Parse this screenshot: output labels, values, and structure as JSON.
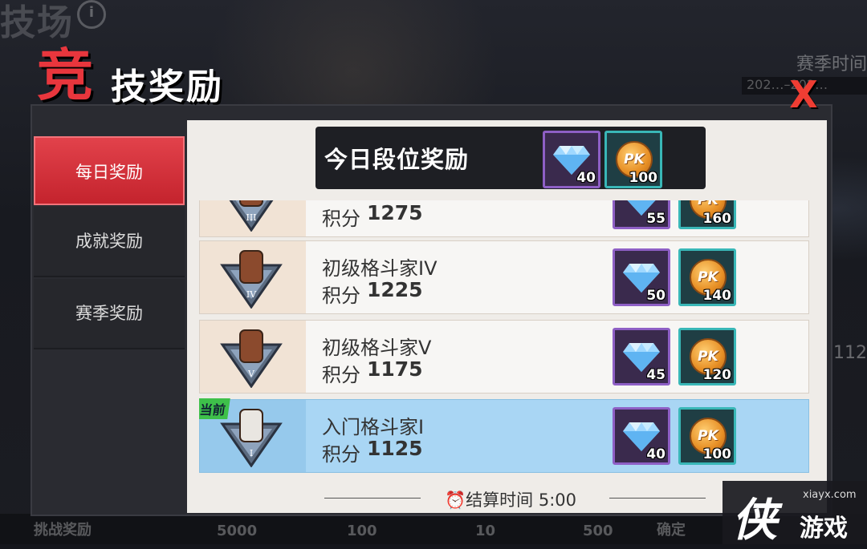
{
  "background": {
    "top_title": "技场",
    "season_label": "赛季时间",
    "season_date": "202…–202…",
    "right_number": "112",
    "bottom_labels": [
      "挑战奖励",
      "5000",
      "100",
      "10",
      "500",
      "确定"
    ]
  },
  "popup": {
    "title_big": "竞",
    "title_rest": "技奖励",
    "close_label": "X"
  },
  "tabs": [
    {
      "label": "每日奖励",
      "active": true
    },
    {
      "label": "成就奖励",
      "active": false
    },
    {
      "label": "赛季奖励",
      "active": false
    }
  ],
  "banner": {
    "title": "今日段位奖励",
    "rewards": [
      {
        "type": "diamond",
        "icon": "diamond-icon",
        "qty": "40"
      },
      {
        "type": "pk_coin",
        "icon": "pk-coin-icon",
        "label": "PK",
        "qty": "100"
      }
    ]
  },
  "rows": [
    {
      "name": "",
      "score_label": "积分",
      "score": "1275",
      "rank_numeral": "III",
      "current": false,
      "rewards": [
        {
          "type": "diamond",
          "qty": "55"
        },
        {
          "type": "pk_coin",
          "qty": "160"
        }
      ]
    },
    {
      "name": "初级格斗家IV",
      "score_label": "积分",
      "score": "1225",
      "rank_numeral": "IV",
      "current": false,
      "rewards": [
        {
          "type": "diamond",
          "qty": "50"
        },
        {
          "type": "pk_coin",
          "qty": "140"
        }
      ]
    },
    {
      "name": "初级格斗家V",
      "score_label": "积分",
      "score": "1175",
      "rank_numeral": "V",
      "current": false,
      "rewards": [
        {
          "type": "diamond",
          "qty": "45"
        },
        {
          "type": "pk_coin",
          "qty": "120"
        }
      ]
    },
    {
      "name": "入门格斗家I",
      "score_label": "积分",
      "score": "1125",
      "rank_numeral": "I",
      "current": true,
      "current_tag": "当前",
      "rewards": [
        {
          "type": "diamond",
          "qty": "40"
        },
        {
          "type": "pk_coin",
          "qty": "100"
        }
      ]
    }
  ],
  "pk_label": "PK",
  "footer": {
    "settle_label": "结算时间",
    "settle_time": "5:00"
  },
  "watermark": {
    "logo": "侠",
    "url": "xiayx.com",
    "name": "游戏"
  },
  "colors": {
    "accent_red": "#e8363d",
    "tab_active": "#d12f38",
    "current_row": "#a9d6f4",
    "diamond_frame": "#8e5fc5",
    "coin_frame": "#39b7b7"
  }
}
